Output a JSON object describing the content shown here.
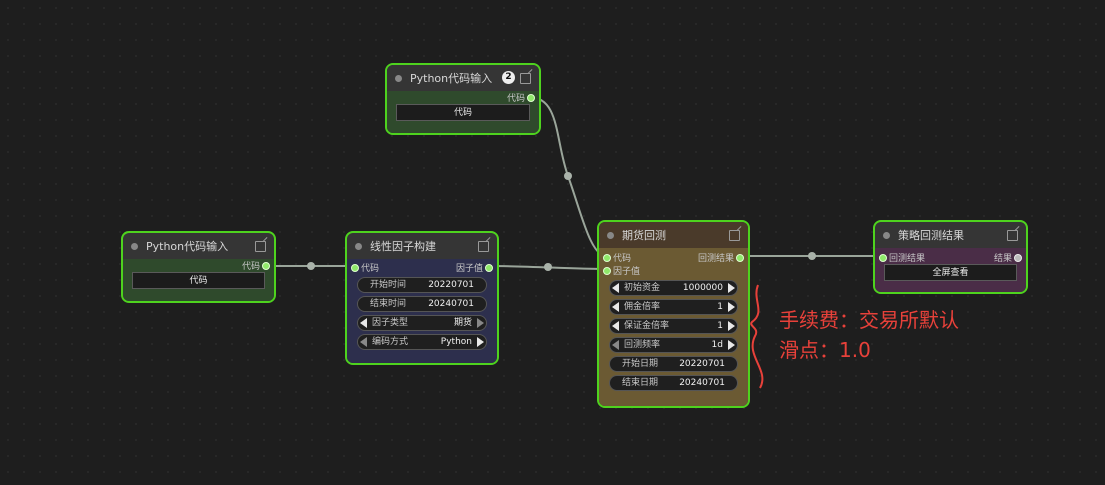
{
  "nodes": {
    "python_top": {
      "title": "Python代码输入",
      "badge": "2",
      "output_label": "代码",
      "button": "代码"
    },
    "python_left": {
      "title": "Python代码输入",
      "output_label": "代码",
      "button": "代码"
    },
    "factor": {
      "title": "线性因子构建",
      "input_label": "代码",
      "output_label": "因子值",
      "fields": [
        {
          "label": "开始时间",
          "value": "20220701"
        },
        {
          "label": "结束时间",
          "value": "20240701"
        },
        {
          "label": "因子类型",
          "value": "期货"
        },
        {
          "label": "编码方式",
          "value": "Python"
        }
      ]
    },
    "backtest": {
      "title": "期货回测",
      "input1_label": "代码",
      "input2_label": "因子值",
      "output_label": "回测结果",
      "fields": [
        {
          "label": "初始资金",
          "value": "1000000"
        },
        {
          "label": "佣金倍率",
          "value": "1"
        },
        {
          "label": "保证金倍率",
          "value": "1"
        },
        {
          "label": "回测频率",
          "value": "1d"
        },
        {
          "label": "开始日期",
          "value": "20220701"
        },
        {
          "label": "结束日期",
          "value": "20240701"
        }
      ]
    },
    "result": {
      "title": "策略回测结果",
      "input_label": "回测结果",
      "output_label": "结果",
      "button": "全屏查看"
    }
  },
  "annotation": {
    "line1": "手续费：交易所默认",
    "line2": "滑点：1.0"
  },
  "colors": {
    "canvas": "#1e1e1e",
    "selection_border": "#4ed31e",
    "python_body": "#2f4a2c",
    "factor_body": "#2d2f4d",
    "backtest_body": "#6b5a33",
    "result_body": "#4a2d47",
    "annotation": "#e8413a"
  }
}
